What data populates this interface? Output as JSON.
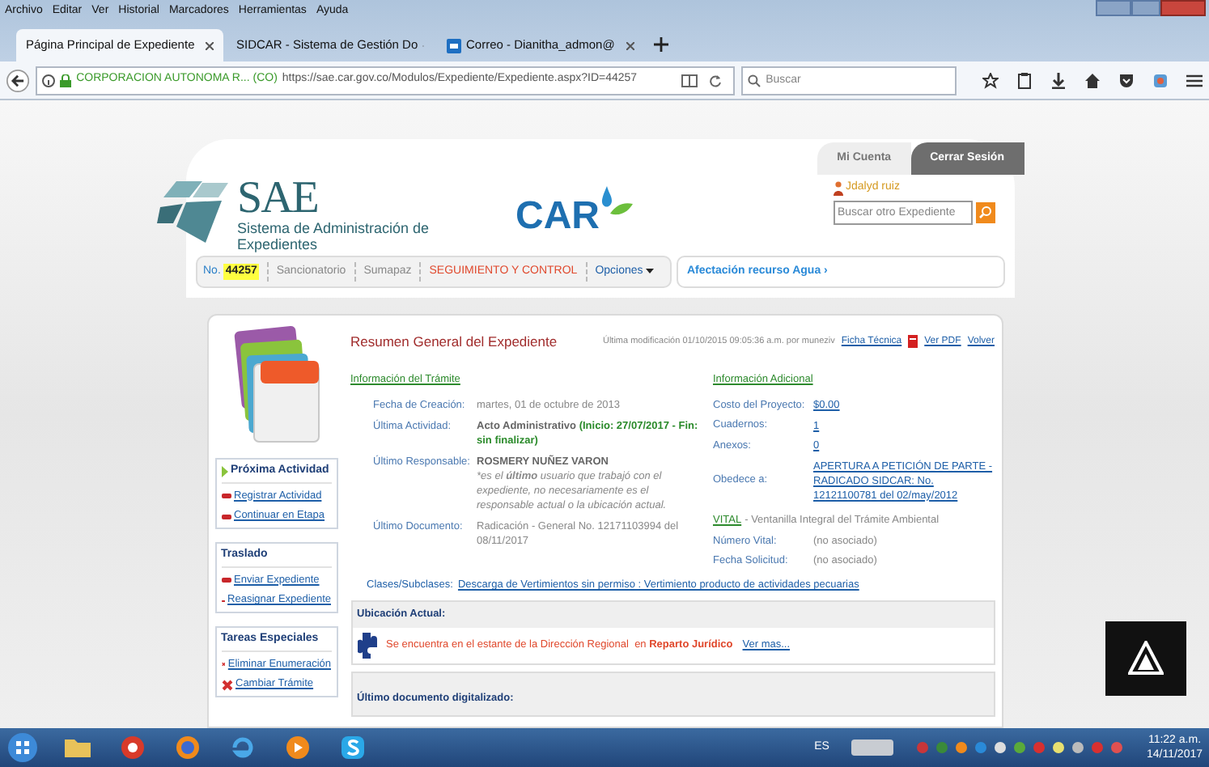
{
  "browser": {
    "menu": [
      "Archivo",
      "Editar",
      "Ver",
      "Historial",
      "Marcadores",
      "Herramientas",
      "Ayuda"
    ],
    "tabs": [
      {
        "label": "Página Principal de Expediente",
        "selected": true
      },
      {
        "label": "SIDCAR - Sistema de Gestión Do",
        "selected": false
      },
      {
        "label": "Correo - Dianitha_admon@",
        "selected": false
      }
    ],
    "site": "CORPORACION AUTONOMA R... (CO)",
    "url": "https://sae.car.gov.co/Modulos/Expediente/Expediente.aspx?ID=44257",
    "search_placeholder": "Buscar"
  },
  "header": {
    "logo_title": "SAE",
    "logo_subtitle": "Sistema de Administración de Expedientes",
    "partner_logo": "CAR",
    "account_tabs": [
      {
        "label": "Mi Cuenta",
        "selected": true
      },
      {
        "label": "Cerrar Sesión",
        "selected": false
      }
    ],
    "user": "Jdalyd ruiz",
    "search_placeholder": "Buscar otro Expediente"
  },
  "nav": {
    "number_label": "No.",
    "number": "44257",
    "items": [
      {
        "label": "Sancionatorio",
        "kind": "plain"
      },
      {
        "label": "Sumapaz",
        "kind": "plain"
      },
      {
        "label": "SEGUIMIENTO Y CONTROL",
        "kind": "alert"
      }
    ],
    "options": "Opciones",
    "side_link": "Afectación recurso Agua ›"
  },
  "summary": {
    "title": "Resumen General del Expediente",
    "modified": "Última modificación 01/10/2015 09:05:36 a.m. por muneziv",
    "links": [
      {
        "label": "Ficha Técnica",
        "kind": "link"
      },
      {
        "label": "Ver PDF",
        "kind": "pdf"
      },
      {
        "label": "Volver",
        "kind": "link"
      }
    ]
  },
  "side_boxes": [
    {
      "title": "Próxima Actividad",
      "kind": "arrow",
      "items": [
        {
          "label": "Registrar Actividad",
          "kind": "dash"
        },
        {
          "label": "Continuar en Etapa",
          "kind": "dash"
        }
      ]
    },
    {
      "title": "Traslado",
      "kind": "plain",
      "items": [
        {
          "label": "Enviar Expediente",
          "kind": "dash"
        },
        {
          "label": "Reasignar Expediente",
          "kind": "dash"
        }
      ]
    },
    {
      "title": "Tareas Especiales",
      "kind": "plain",
      "items": [
        {
          "label": "Eliminar Enumeración",
          "kind": "cross"
        },
        {
          "label": "Cambiar Trámite",
          "kind": "cross"
        }
      ]
    }
  ],
  "tramite": {
    "heading": "Información del Trámite",
    "fields": [
      {
        "label": "Fecha de Creación:",
        "kind": "plain",
        "value": "martes, 01 de octubre de 2013"
      },
      {
        "label": "Última Actividad:",
        "kind": "activity",
        "value": "Acto Administrativo",
        "status": "(Inicio: 27/07/2017 - Fin: sin finalizar)"
      },
      {
        "label": "Último Responsable:",
        "kind": "person",
        "value": "ROSMERY NUÑEZ VARON",
        "note": "*es el **último** usuario que trabajó con el expediente, no necesariamente es el responsable actual o la ubicación actual."
      },
      {
        "label": "Último Documento:",
        "kind": "plain",
        "value": "Radicación - General No. 12171103994 del 08/11/2017"
      }
    ]
  },
  "adicional": {
    "heading": "Información Adicional",
    "fields": [
      {
        "label": "Costo del Proyecto:",
        "value": "$0.00"
      },
      {
        "label": "Cuadernos:",
        "value": "1"
      },
      {
        "label": "Anexos:",
        "value": "0"
      },
      {
        "label": "Obedece a:",
        "value": "APERTURA A PETICIÓN DE PARTE - RADICADO SIDCAR: No. 12121100781 del 02/may/2012"
      }
    ],
    "vital_link": "VITAL",
    "vital_text": "- Ventanilla Integral del Trámite Ambiental",
    "vital_fields": [
      {
        "label": "Número Vital:",
        "value": "(no asociado)"
      },
      {
        "label": "Fecha Solicitud:",
        "value": "(no asociado)"
      }
    ]
  },
  "classes": {
    "label": "Clases/Subclases:",
    "value": "Descarga de Vertimientos sin permiso : Vertimiento producto de actividades pecuarias"
  },
  "location": {
    "title": "Ubicación Actual:",
    "text": "Se encuentra en el estante de la Dirección Regional  en **Reparto Jurídico**",
    "link": "Ver mas..."
  },
  "last_digitized": {
    "title": "Último documento digitalizado:"
  },
  "taskbar": {
    "language": "ES",
    "time": "11:22 a.m.",
    "date": "14/11/2017"
  }
}
